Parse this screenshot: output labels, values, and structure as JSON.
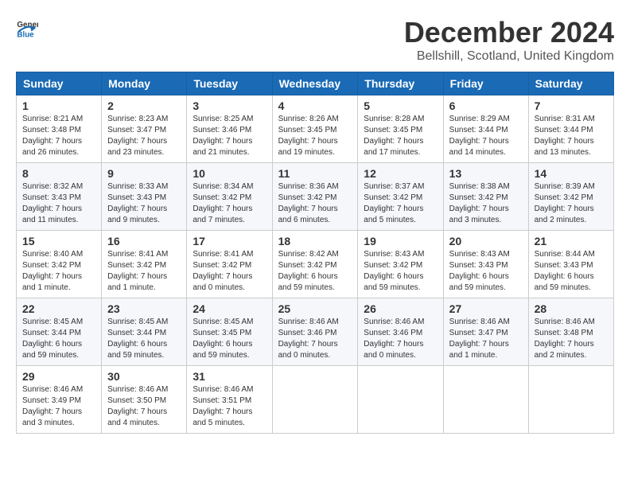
{
  "logo": {
    "general": "General",
    "blue": "Blue"
  },
  "title": "December 2024",
  "location": "Bellshill, Scotland, United Kingdom",
  "days_header": [
    "Sunday",
    "Monday",
    "Tuesday",
    "Wednesday",
    "Thursday",
    "Friday",
    "Saturday"
  ],
  "weeks": [
    [
      {
        "day": "1",
        "sunrise": "8:21 AM",
        "sunset": "3:48 PM",
        "daylight": "7 hours and 26 minutes."
      },
      {
        "day": "2",
        "sunrise": "8:23 AM",
        "sunset": "3:47 PM",
        "daylight": "7 hours and 23 minutes."
      },
      {
        "day": "3",
        "sunrise": "8:25 AM",
        "sunset": "3:46 PM",
        "daylight": "7 hours and 21 minutes."
      },
      {
        "day": "4",
        "sunrise": "8:26 AM",
        "sunset": "3:45 PM",
        "daylight": "7 hours and 19 minutes."
      },
      {
        "day": "5",
        "sunrise": "8:28 AM",
        "sunset": "3:45 PM",
        "daylight": "7 hours and 17 minutes."
      },
      {
        "day": "6",
        "sunrise": "8:29 AM",
        "sunset": "3:44 PM",
        "daylight": "7 hours and 14 minutes."
      },
      {
        "day": "7",
        "sunrise": "8:31 AM",
        "sunset": "3:44 PM",
        "daylight": "7 hours and 13 minutes."
      }
    ],
    [
      {
        "day": "8",
        "sunrise": "8:32 AM",
        "sunset": "3:43 PM",
        "daylight": "7 hours and 11 minutes."
      },
      {
        "day": "9",
        "sunrise": "8:33 AM",
        "sunset": "3:43 PM",
        "daylight": "7 hours and 9 minutes."
      },
      {
        "day": "10",
        "sunrise": "8:34 AM",
        "sunset": "3:42 PM",
        "daylight": "7 hours and 7 minutes."
      },
      {
        "day": "11",
        "sunrise": "8:36 AM",
        "sunset": "3:42 PM",
        "daylight": "7 hours and 6 minutes."
      },
      {
        "day": "12",
        "sunrise": "8:37 AM",
        "sunset": "3:42 PM",
        "daylight": "7 hours and 5 minutes."
      },
      {
        "day": "13",
        "sunrise": "8:38 AM",
        "sunset": "3:42 PM",
        "daylight": "7 hours and 3 minutes."
      },
      {
        "day": "14",
        "sunrise": "8:39 AM",
        "sunset": "3:42 PM",
        "daylight": "7 hours and 2 minutes."
      }
    ],
    [
      {
        "day": "15",
        "sunrise": "8:40 AM",
        "sunset": "3:42 PM",
        "daylight": "7 hours and 1 minute."
      },
      {
        "day": "16",
        "sunrise": "8:41 AM",
        "sunset": "3:42 PM",
        "daylight": "7 hours and 1 minute."
      },
      {
        "day": "17",
        "sunrise": "8:41 AM",
        "sunset": "3:42 PM",
        "daylight": "7 hours and 0 minutes."
      },
      {
        "day": "18",
        "sunrise": "8:42 AM",
        "sunset": "3:42 PM",
        "daylight": "6 hours and 59 minutes."
      },
      {
        "day": "19",
        "sunrise": "8:43 AM",
        "sunset": "3:42 PM",
        "daylight": "6 hours and 59 minutes."
      },
      {
        "day": "20",
        "sunrise": "8:43 AM",
        "sunset": "3:43 PM",
        "daylight": "6 hours and 59 minutes."
      },
      {
        "day": "21",
        "sunrise": "8:44 AM",
        "sunset": "3:43 PM",
        "daylight": "6 hours and 59 minutes."
      }
    ],
    [
      {
        "day": "22",
        "sunrise": "8:45 AM",
        "sunset": "3:44 PM",
        "daylight": "6 hours and 59 minutes."
      },
      {
        "day": "23",
        "sunrise": "8:45 AM",
        "sunset": "3:44 PM",
        "daylight": "6 hours and 59 minutes."
      },
      {
        "day": "24",
        "sunrise": "8:45 AM",
        "sunset": "3:45 PM",
        "daylight": "6 hours and 59 minutes."
      },
      {
        "day": "25",
        "sunrise": "8:46 AM",
        "sunset": "3:46 PM",
        "daylight": "7 hours and 0 minutes."
      },
      {
        "day": "26",
        "sunrise": "8:46 AM",
        "sunset": "3:46 PM",
        "daylight": "7 hours and 0 minutes."
      },
      {
        "day": "27",
        "sunrise": "8:46 AM",
        "sunset": "3:47 PM",
        "daylight": "7 hours and 1 minute."
      },
      {
        "day": "28",
        "sunrise": "8:46 AM",
        "sunset": "3:48 PM",
        "daylight": "7 hours and 2 minutes."
      }
    ],
    [
      {
        "day": "29",
        "sunrise": "8:46 AM",
        "sunset": "3:49 PM",
        "daylight": "7 hours and 3 minutes."
      },
      {
        "day": "30",
        "sunrise": "8:46 AM",
        "sunset": "3:50 PM",
        "daylight": "7 hours and 4 minutes."
      },
      {
        "day": "31",
        "sunrise": "8:46 AM",
        "sunset": "3:51 PM",
        "daylight": "7 hours and 5 minutes."
      },
      null,
      null,
      null,
      null
    ]
  ]
}
